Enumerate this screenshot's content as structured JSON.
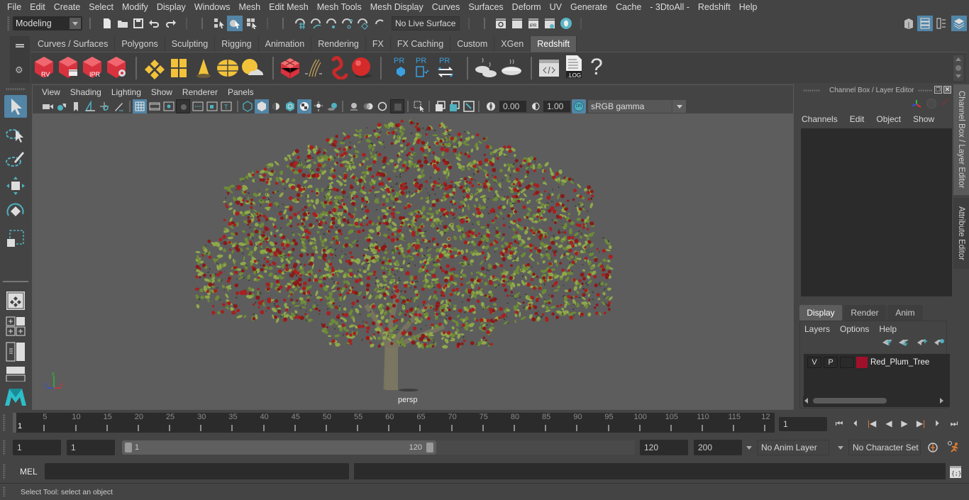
{
  "menubar": {
    "items": [
      "File",
      "Edit",
      "Create",
      "Select",
      "Modify",
      "Display",
      "Windows",
      "Mesh",
      "Edit Mesh",
      "Mesh Tools",
      "Mesh Display",
      "Curves",
      "Surfaces",
      "Deform",
      "UV",
      "Generate",
      "Cache",
      "- 3DtoAll -",
      "Redshift",
      "Help"
    ]
  },
  "statusline": {
    "mode": "Modeling",
    "live_surface": "No Live Surface"
  },
  "shelf": {
    "tabs": [
      "Curves / Surfaces",
      "Polygons",
      "Sculpting",
      "Rigging",
      "Animation",
      "Rendering",
      "FX",
      "FX Caching",
      "Custom",
      "XGen",
      "Redshift"
    ],
    "active_tab": "Redshift",
    "icon_labels": {
      "rv": "RV",
      "ipr": "IPR",
      "pr": "PR",
      "log": ".LOG",
      "help": "?"
    }
  },
  "viewport": {
    "menus": [
      "View",
      "Shading",
      "Lighting",
      "Show",
      "Renderer",
      "Panels"
    ],
    "exposure": "0.00",
    "gamma": "1.00",
    "color_mgmt_on": "ON",
    "color_space": "sRGB gamma",
    "camera_label": "persp",
    "axis": {
      "x": "x",
      "y": "y",
      "z": "z"
    },
    "colors": {
      "x": "#e03030",
      "y": "#30c030",
      "z": "#3050e0"
    }
  },
  "channel_box": {
    "title": "Channel Box / Layer Editor",
    "menus": [
      "Channels",
      "Edit",
      "Object",
      "Show"
    ]
  },
  "layer_editor": {
    "tabs": [
      "Display",
      "Render",
      "Anim"
    ],
    "active_tab": "Display",
    "menus": [
      "Layers",
      "Options",
      "Help"
    ],
    "layers": [
      {
        "visible": "V",
        "playback": "P",
        "color": "#a0102a",
        "name": "Red_Plum_Tree"
      }
    ]
  },
  "side_tabs": [
    "Channel Box / Layer Editor",
    "Attribute Editor"
  ],
  "timeline": {
    "ticks": [
      "5",
      "10",
      "15",
      "20",
      "25",
      "30",
      "35",
      "40",
      "45",
      "50",
      "55",
      "60",
      "65",
      "70",
      "75",
      "80",
      "85",
      "90",
      "95",
      "100",
      "105",
      "110",
      "115",
      "12"
    ],
    "current_marker": "1",
    "current_frame": "1"
  },
  "range": {
    "start": "1",
    "playback_start": "1",
    "slider_start": "1",
    "slider_end": "120",
    "playback_end": "120",
    "end": "200",
    "anim_layer": "No Anim Layer",
    "character_set": "No Character Set"
  },
  "command_line": {
    "language": "MEL",
    "input": "",
    "output": ""
  },
  "help_line": "Select Tool: select an object"
}
